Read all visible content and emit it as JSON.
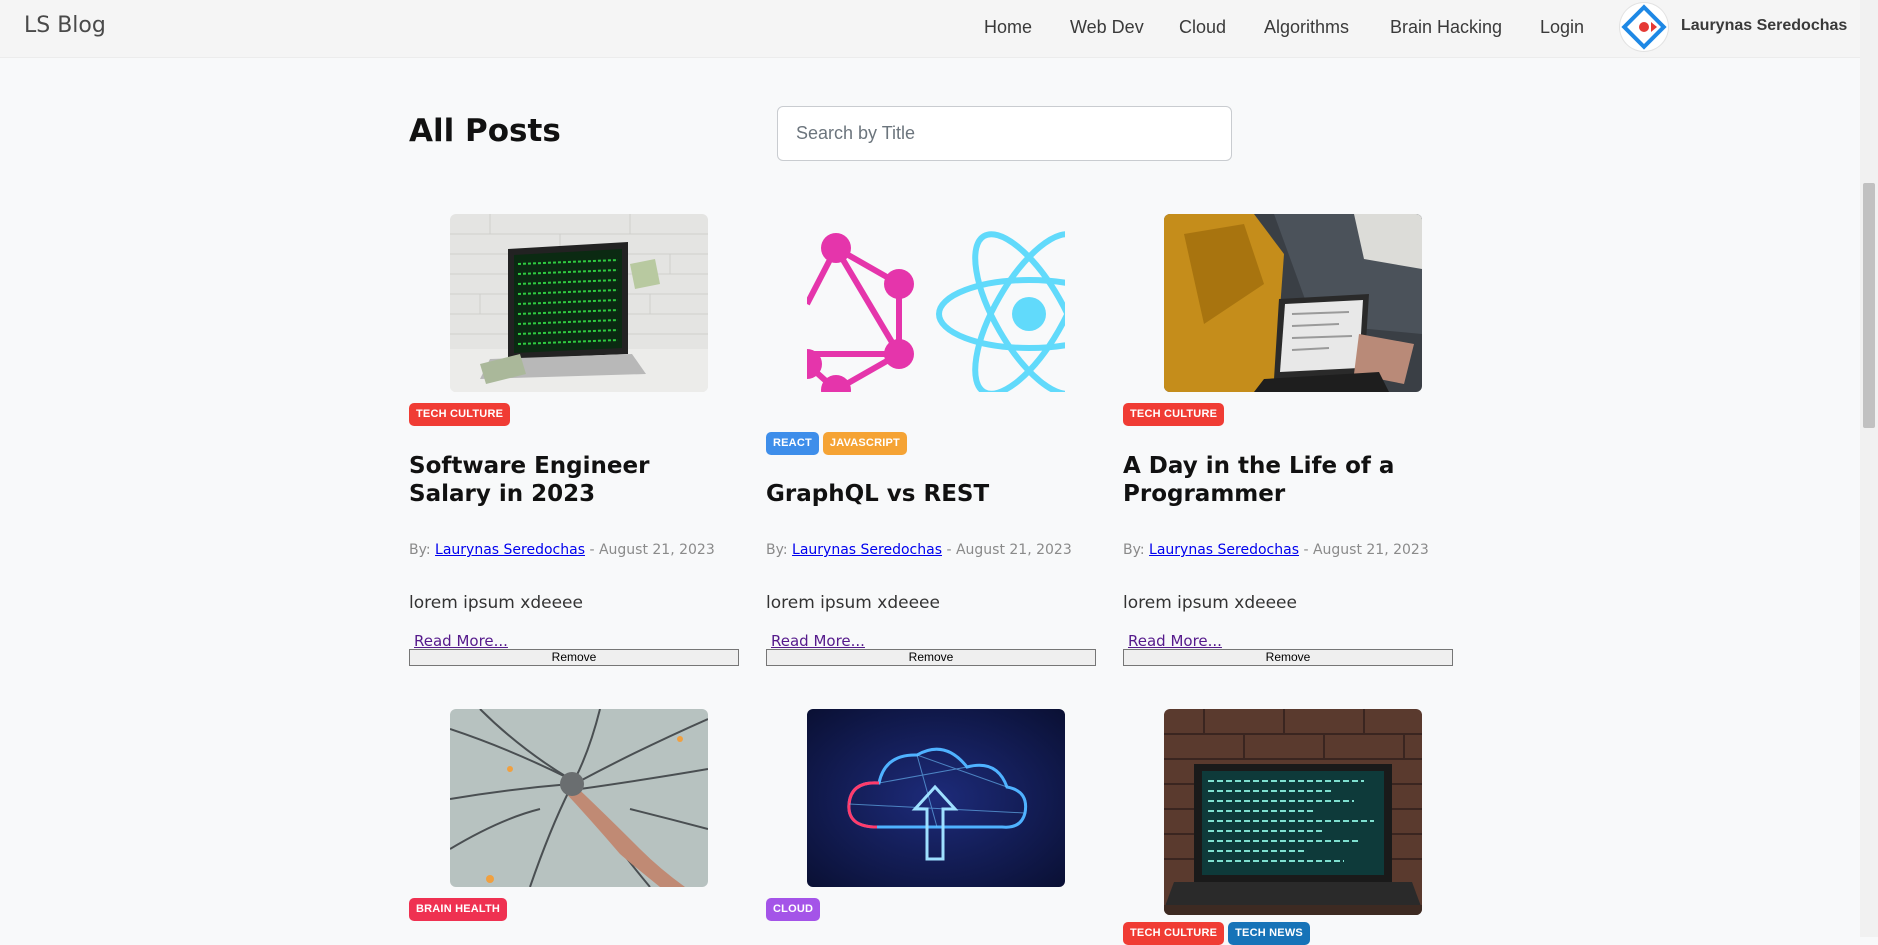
{
  "nav": {
    "brand": "LS Blog",
    "links": [
      "Home",
      "Web Dev",
      "Cloud",
      "Algorithms",
      "Brain Hacking",
      "Login"
    ],
    "user_name": "Laurynas Seredochas"
  },
  "header": {
    "title": "All Posts",
    "search_placeholder": "Search by Title"
  },
  "posts": [
    {
      "image": "laptop-code-money-image",
      "tags": [
        {
          "label": "Tech Culture",
          "color": "#f03c34"
        }
      ],
      "title": "Software Engineer Salary in 2023",
      "by_label": "By:",
      "author": "Laurynas Seredochas",
      "date": "- August 21, 2023",
      "excerpt": "lorem ipsum xdeeee",
      "read_more": "Read More...",
      "remove": "Remove"
    },
    {
      "image": "graphql-react-logos-image",
      "tags": [
        {
          "label": "React",
          "color": "#3e8eea"
        },
        {
          "label": "JavaScript",
          "color": "#f5a334"
        }
      ],
      "title": "GraphQL vs REST",
      "by_label": "By:",
      "author": "Laurynas Seredochas",
      "date": "- August 21, 2023",
      "excerpt": "lorem ipsum xdeeee",
      "read_more": "Read More...",
      "remove": "Remove"
    },
    {
      "image": "person-typing-laptop-image",
      "tags": [
        {
          "label": "Tech Culture",
          "color": "#f03c34"
        }
      ],
      "title": "A Day in the Life of a Programmer",
      "by_label": "By:",
      "author": "Laurynas Seredochas",
      "date": "- August 21, 2023",
      "excerpt": "lorem ipsum xdeeee",
      "read_more": "Read More...",
      "remove": "Remove"
    },
    {
      "image": "neuron-network-image",
      "tags": [
        {
          "label": "Brain Health",
          "color": "#ef3151"
        }
      ]
    },
    {
      "image": "cloud-upload-image",
      "tags": [
        {
          "label": "Cloud",
          "color": "#a454e8"
        }
      ]
    },
    {
      "image": "laptop-brick-wall-image",
      "tags": [
        {
          "label": "Tech Culture",
          "color": "#f03c34"
        },
        {
          "label": "Tech News",
          "color": "#1673b8"
        }
      ]
    }
  ]
}
